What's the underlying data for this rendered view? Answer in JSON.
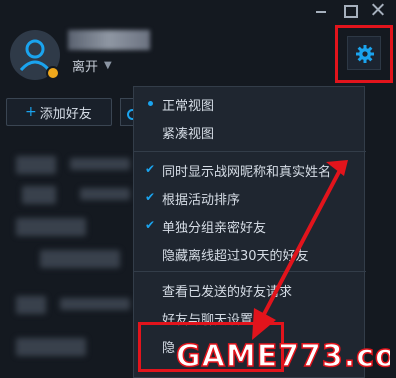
{
  "header": {
    "status_text": "离开"
  },
  "toolbar": {
    "add_friend_label": "添加好友"
  },
  "menu": {
    "view_items": [
      {
        "label": "正常视图",
        "selected": true
      },
      {
        "label": "紧凑视图",
        "selected": false
      }
    ],
    "option_items": [
      {
        "label": "同时显示战网昵称和真实姓名",
        "checked": true
      },
      {
        "label": "根据活动排序",
        "checked": true
      },
      {
        "label": "单独分组亲密好友",
        "checked": true
      },
      {
        "label": "隐藏离线超过30天的好友",
        "checked": false
      }
    ],
    "action_items": [
      {
        "label": "查看已发送的好友请求"
      },
      {
        "label": "好友与聊天设置"
      },
      {
        "label": "隐"
      }
    ]
  },
  "watermark": {
    "text": "GAME773.com"
  },
  "colors": {
    "background": "#141920",
    "menu_bg": "#1f2630",
    "accent_blue": "#1aa4ef",
    "status_away": "#f0a81c",
    "annotation_red": "#e2141c"
  }
}
